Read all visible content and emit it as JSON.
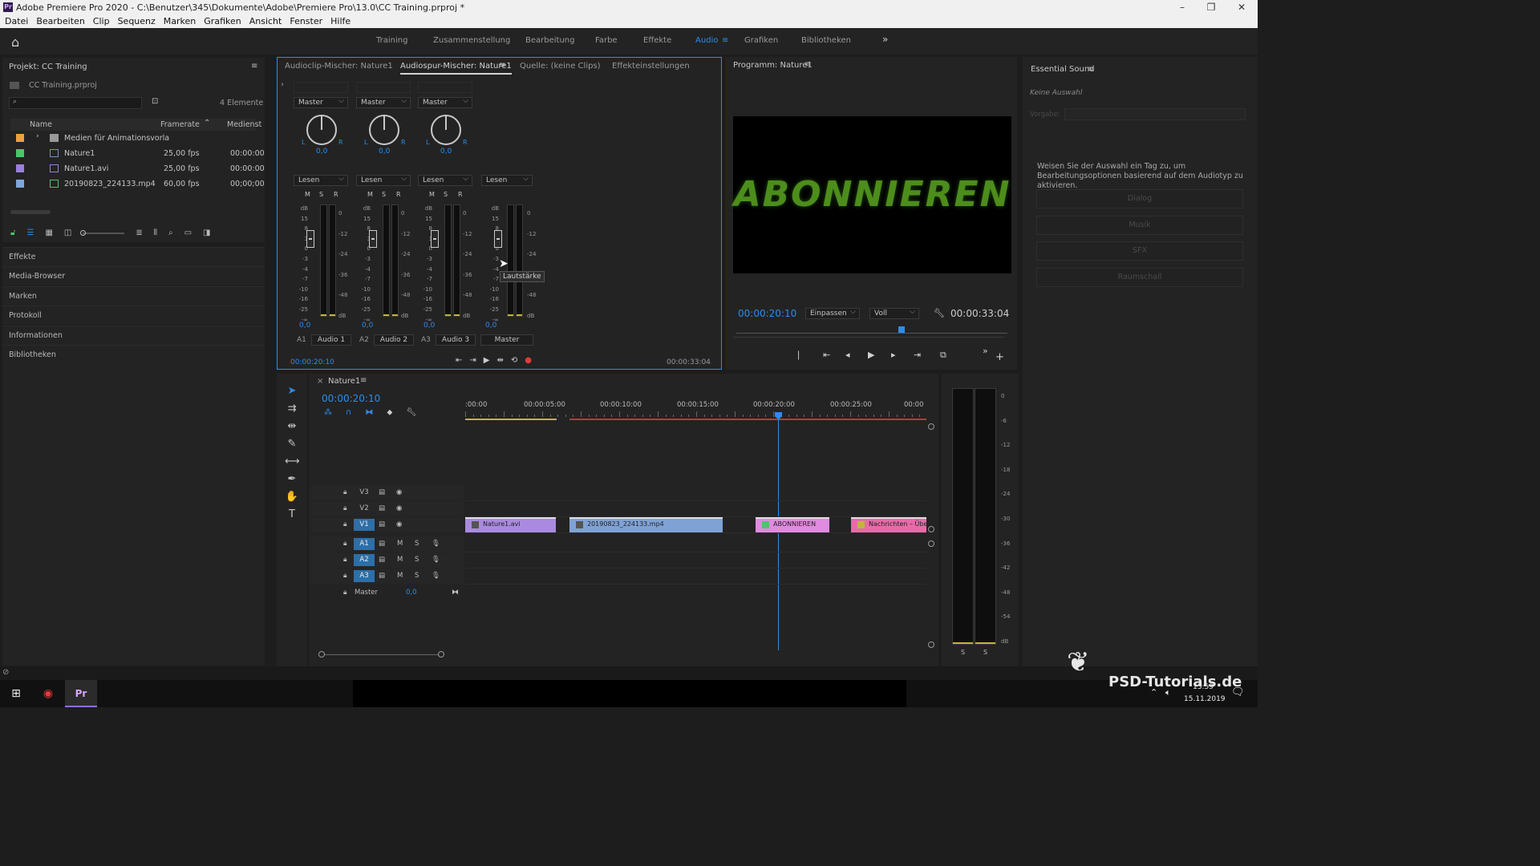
{
  "app": {
    "title": "Adobe Premiere Pro 2020 - C:\\Benutzer\\345\\Dokumente\\Adobe\\Premiere Pro\\13.0\\CC Training.prproj *",
    "icon_label": "Pr",
    "window_controls": [
      "–",
      "❐",
      "✕"
    ]
  },
  "menu": [
    "Datei",
    "Bearbeiten",
    "Clip",
    "Sequenz",
    "Marken",
    "Grafiken",
    "Ansicht",
    "Fenster",
    "Hilfe"
  ],
  "workspaces": {
    "items": [
      "Training",
      "Zusammenstellung",
      "Bearbeitung",
      "Farbe",
      "Effekte",
      "Audio",
      "Grafiken",
      "Bibliotheken"
    ],
    "active": "Audio",
    "more": "»"
  },
  "project": {
    "title": "Projekt: CC Training",
    "file": "CC Training.prproj",
    "count": "4 Elemente",
    "columns": [
      "Name",
      "Framerate",
      "Medienst"
    ],
    "rows": [
      {
        "name": "Medien für Animationsvorla",
        "fps": "",
        "tc": "",
        "color": "#e8a33d"
      },
      {
        "name": "Nature1",
        "fps": "25,00 fps",
        "tc": "00:00:00",
        "color": "#4fc36a"
      },
      {
        "name": "Nature1.avi",
        "fps": "25,00 fps",
        "tc": "00:00:00",
        "color": "#9b7fdc"
      },
      {
        "name": "20190823_224133.mp4",
        "fps": "60,00 fps",
        "tc": "00;00;00",
        "color": "#7fa6dc"
      }
    ]
  },
  "side_panels": [
    "Effekte",
    "Media-Browser",
    "Marken",
    "Protokoll",
    "Informationen",
    "Bibliotheken"
  ],
  "mixer": {
    "tabs": [
      "Audioclip-Mischer: Nature1",
      "Audiospur-Mischer: Nature1",
      "Quelle: (keine Clips)",
      "Effekteinstellungen"
    ],
    "channels": [
      {
        "route": "Master",
        "mode": "Lesen",
        "pan": "0,0",
        "vol": "0,0",
        "id": "A1",
        "name": "Audio 1"
      },
      {
        "route": "Master",
        "mode": "Lesen",
        "pan": "0,0",
        "vol": "0,0",
        "id": "A2",
        "name": "Audio 2"
      },
      {
        "route": "Master",
        "mode": "Lesen",
        "pan": "0,0",
        "vol": "0,0",
        "id": "A3",
        "name": "Audio 3"
      }
    ],
    "master": {
      "mode": "Lesen",
      "vol": "0,0",
      "name": "Master"
    },
    "msr": [
      "M",
      "S",
      "R"
    ],
    "lr": [
      "L",
      "R"
    ],
    "fader_scale": [
      "dB",
      "15",
      "8",
      "3",
      "0",
      "-3",
      "-4",
      "-7",
      "-10",
      "-16",
      "-25",
      "-∞"
    ],
    "meter_scale": [
      "0",
      "-12",
      "-24",
      "-36",
      "-48",
      "dB"
    ],
    "tooltip": "Lautstärke",
    "time_left": "00:00:20:10",
    "time_right": "00:00:33:04"
  },
  "program": {
    "title": "Programm: Nature1",
    "video_text": "ABONNIEREN",
    "timecode": "00:00:20:10",
    "fit": "Einpassen",
    "quality": "Voll",
    "duration": "00:00:33:04"
  },
  "essential": {
    "title": "Essential Sound",
    "state": "Keine Auswahl",
    "preset_label": "Vorgabe:",
    "hint": "Weisen Sie der Auswahl ein Tag zu, um Bearbeitungsoptionen basierend auf dem Audiotyp zu aktivieren.",
    "buttons": [
      "Dialog",
      "Musik",
      "SFX",
      "Raumschall"
    ]
  },
  "timeline": {
    "tab": "Nature1",
    "timecode": "00:00:20:10",
    "ruler": [
      ":00:00",
      "00:00:05:00",
      "00:00:10:00",
      "00:00:15:00",
      "00:00:20:00",
      "00:00:25:00",
      "00:00"
    ],
    "video_tracks": [
      "V3",
      "V2",
      "V1"
    ],
    "audio_tracks": [
      "A1",
      "A2",
      "A3"
    ],
    "master_label": "Master",
    "master_value": "0,0",
    "clips": [
      {
        "name": "Nature1.avi",
        "color": "#a98ae0"
      },
      {
        "name": "20190823_224133.mp4",
        "color": "#7fa2d6"
      },
      {
        "name": "ABONNIEREN",
        "color": "#e08ae0"
      },
      {
        "name": "Nachrichten – Überi",
        "color": "#e86aa8"
      }
    ]
  },
  "audio_meter": {
    "scale": [
      "0",
      "-6",
      "-12",
      "-18",
      "-24",
      "-30",
      "-36",
      "-42",
      "-48",
      "-54",
      "dB"
    ],
    "solo": [
      "S",
      "S"
    ]
  },
  "taskbar": {
    "time": "13:59",
    "date": "15.11.2019"
  },
  "watermark": "PSD-Tutorials.de"
}
